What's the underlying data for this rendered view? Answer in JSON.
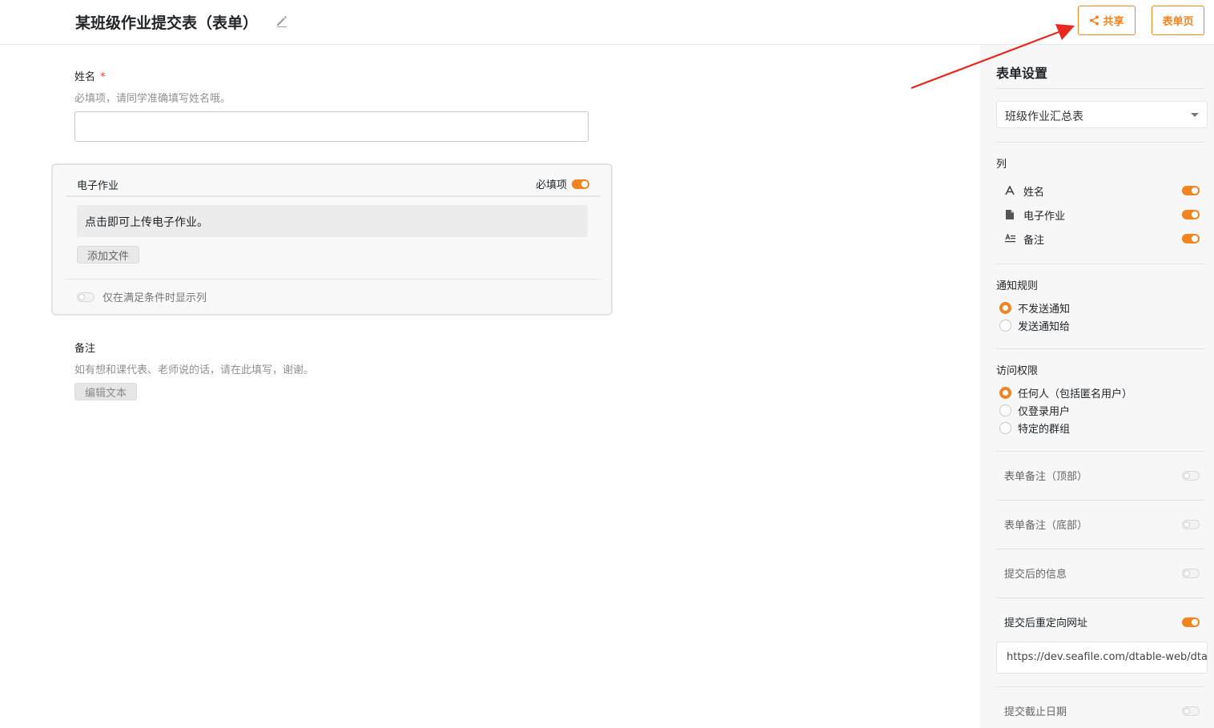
{
  "header": {
    "title": "某班级作业提交表（表单）",
    "share_label": "共享",
    "form_page_label": "表单页"
  },
  "form": {
    "name_field": {
      "label": "姓名",
      "required_mark": "*",
      "description": "必填项，请同学准确填写姓名哦。",
      "value": ""
    },
    "file_field": {
      "label": "电子作业",
      "required_label": "必填项",
      "required_on": true,
      "description": "点击即可上传电子作业。",
      "add_file_label": "添加文件",
      "condition_label": "仅在满足条件时显示列",
      "condition_on": false
    },
    "note_field": {
      "label": "备注",
      "description": "如有想和课代表、老师说的话，请在此填写，谢谢。",
      "edit_text_label": "编辑文本"
    }
  },
  "sidebar": {
    "title": "表单设置",
    "selected_table": "班级作业汇总表",
    "columns_title": "列",
    "columns": [
      {
        "label": "姓名",
        "icon": "text-icon",
        "on": true
      },
      {
        "label": "电子作业",
        "icon": "file-icon",
        "on": true
      },
      {
        "label": "备注",
        "icon": "long-text-icon",
        "on": true
      }
    ],
    "notify_title": "通知规则",
    "notify_options": [
      {
        "label": "不发送通知",
        "checked": true
      },
      {
        "label": "发送通知给",
        "checked": false
      }
    ],
    "access_title": "访问权限",
    "access_options": [
      {
        "label": "任何人（包括匿名用户）",
        "checked": true
      },
      {
        "label": "仅登录用户",
        "checked": false
      },
      {
        "label": "特定的群组",
        "checked": false
      }
    ],
    "options": {
      "top_note": {
        "label": "表单备注（顶部）",
        "on": false
      },
      "bottom_note": {
        "label": "表单备注（底部）",
        "on": false
      },
      "after_submit": {
        "label": "提交后的信息",
        "on": false
      },
      "redirect": {
        "label": "提交后重定向网址",
        "on": true
      },
      "deadline": {
        "label": "提交截止日期",
        "on": false
      }
    },
    "redirect_url": "https://dev.seafile.com/dtable-web/dtable/forms/"
  },
  "colors": {
    "accent": "#f08420",
    "annotation_arrow": "#e8281e"
  }
}
